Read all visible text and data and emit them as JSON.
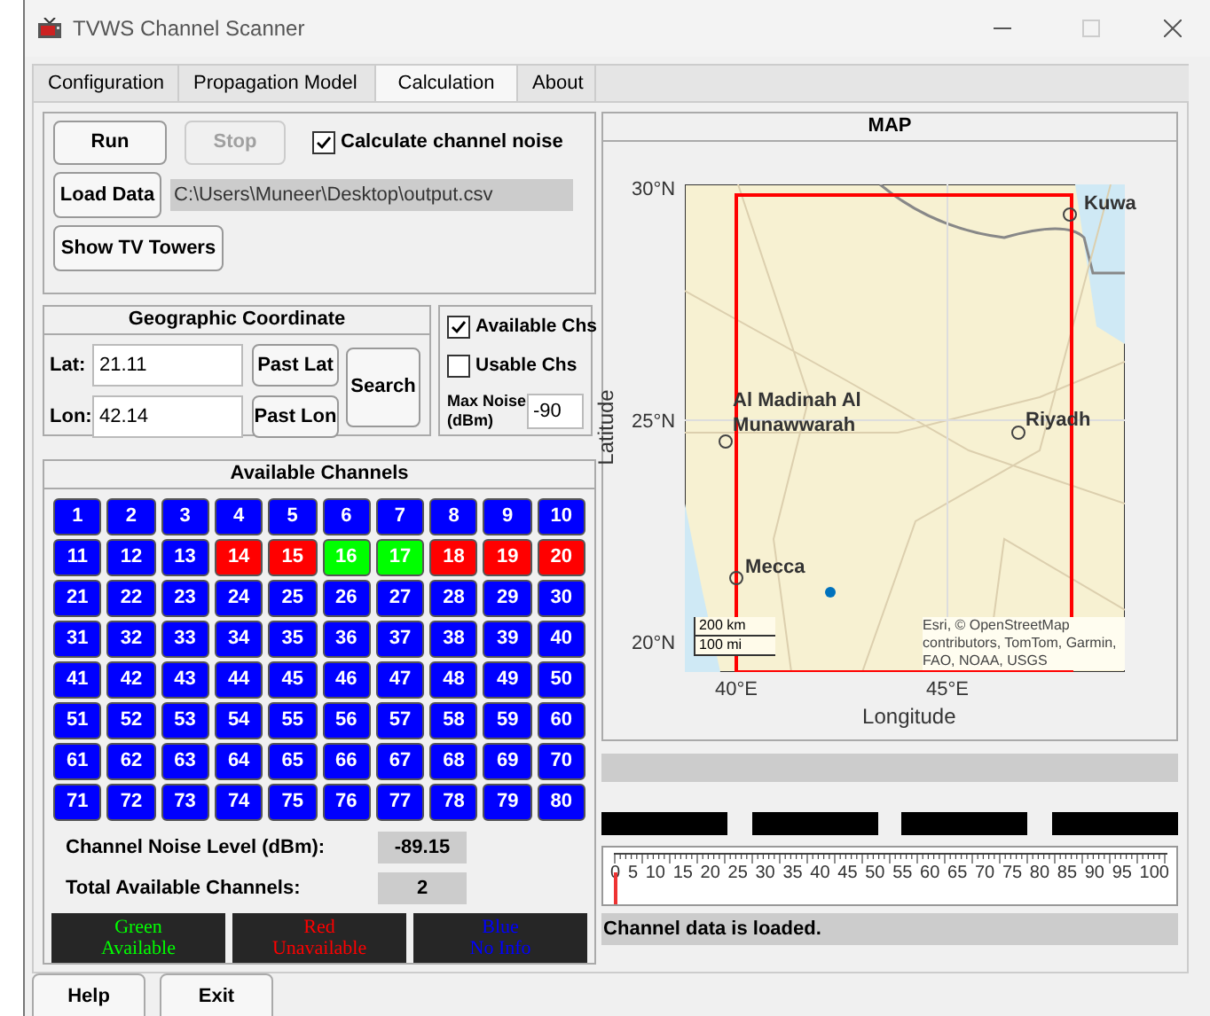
{
  "window": {
    "title": "TVWS Channel Scanner"
  },
  "tabs": [
    {
      "label": "Configuration",
      "selected": false
    },
    {
      "label": "Propagation Model",
      "selected": false
    },
    {
      "label": "Calculation",
      "selected": true
    },
    {
      "label": "About",
      "selected": false
    }
  ],
  "controls": {
    "run": {
      "label": "Run",
      "disabled": false
    },
    "stop": {
      "label": "Stop",
      "disabled": true
    },
    "calc_noise": {
      "label": "Calculate channel noise",
      "checked": true
    },
    "load_data": "Load Data",
    "file_path": "C:\\Users\\Muneer\\Desktop\\output.csv",
    "show_towers": "Show TV Towers"
  },
  "geo": {
    "title": "Geographic Coordinate",
    "lat_label": "Lat:",
    "lat": "21.11",
    "past_lat": "Past Lat",
    "lon_label": "Lon:",
    "lon": "42.14",
    "past_lon": "Past Lon",
    "search": "Search"
  },
  "filters": {
    "available": {
      "label": "Available Chs",
      "checked": true
    },
    "usable": {
      "label": "Usable Chs",
      "checked": false
    },
    "max_noise_label": "Max Noise (dBm)",
    "max_noise": "-90"
  },
  "channels": {
    "title": "Available Channels",
    "items": [
      {
        "label": "1",
        "kind": "noinfo"
      },
      {
        "label": "2",
        "kind": "noinfo"
      },
      {
        "label": "3",
        "kind": "noinfo"
      },
      {
        "label": "4",
        "kind": "noinfo"
      },
      {
        "label": "5",
        "kind": "noinfo"
      },
      {
        "label": "6",
        "kind": "noinfo"
      },
      {
        "label": "7",
        "kind": "noinfo"
      },
      {
        "label": "8",
        "kind": "noinfo"
      },
      {
        "label": "9",
        "kind": "noinfo"
      },
      {
        "label": "10",
        "kind": "noinfo"
      },
      {
        "label": "11",
        "kind": "noinfo"
      },
      {
        "label": "12",
        "kind": "noinfo"
      },
      {
        "label": "13",
        "kind": "noinfo"
      },
      {
        "label": "14",
        "kind": "unavailable"
      },
      {
        "label": "15",
        "kind": "unavailable"
      },
      {
        "label": "16",
        "kind": "available"
      },
      {
        "label": "17",
        "kind": "available"
      },
      {
        "label": "18",
        "kind": "unavailable"
      },
      {
        "label": "19",
        "kind": "unavailable"
      },
      {
        "label": "20",
        "kind": "unavailable"
      },
      {
        "label": "21",
        "kind": "noinfo"
      },
      {
        "label": "22",
        "kind": "noinfo"
      },
      {
        "label": "23",
        "kind": "noinfo"
      },
      {
        "label": "24",
        "kind": "noinfo"
      },
      {
        "label": "25",
        "kind": "noinfo"
      },
      {
        "label": "26",
        "kind": "noinfo"
      },
      {
        "label": "27",
        "kind": "noinfo"
      },
      {
        "label": "28",
        "kind": "noinfo"
      },
      {
        "label": "29",
        "kind": "noinfo"
      },
      {
        "label": "30",
        "kind": "noinfo"
      },
      {
        "label": "31",
        "kind": "noinfo"
      },
      {
        "label": "32",
        "kind": "noinfo"
      },
      {
        "label": "33",
        "kind": "noinfo"
      },
      {
        "label": "34",
        "kind": "noinfo"
      },
      {
        "label": "35",
        "kind": "noinfo"
      },
      {
        "label": "36",
        "kind": "noinfo"
      },
      {
        "label": "37",
        "kind": "noinfo"
      },
      {
        "label": "38",
        "kind": "noinfo"
      },
      {
        "label": "39",
        "kind": "noinfo"
      },
      {
        "label": "40",
        "kind": "noinfo"
      },
      {
        "label": "41",
        "kind": "noinfo"
      },
      {
        "label": "42",
        "kind": "noinfo"
      },
      {
        "label": "43",
        "kind": "noinfo"
      },
      {
        "label": "44",
        "kind": "noinfo"
      },
      {
        "label": "45",
        "kind": "noinfo"
      },
      {
        "label": "46",
        "kind": "noinfo"
      },
      {
        "label": "47",
        "kind": "noinfo"
      },
      {
        "label": "48",
        "kind": "noinfo"
      },
      {
        "label": "49",
        "kind": "noinfo"
      },
      {
        "label": "50",
        "kind": "noinfo"
      },
      {
        "label": "51",
        "kind": "noinfo"
      },
      {
        "label": "52",
        "kind": "noinfo"
      },
      {
        "label": "53",
        "kind": "noinfo"
      },
      {
        "label": "54",
        "kind": "noinfo"
      },
      {
        "label": "55",
        "kind": "noinfo"
      },
      {
        "label": "56",
        "kind": "noinfo"
      },
      {
        "label": "57",
        "kind": "noinfo"
      },
      {
        "label": "58",
        "kind": "noinfo"
      },
      {
        "label": "59",
        "kind": "noinfo"
      },
      {
        "label": "60",
        "kind": "noinfo"
      },
      {
        "label": "61",
        "kind": "noinfo"
      },
      {
        "label": "62",
        "kind": "noinfo"
      },
      {
        "label": "63",
        "kind": "noinfo"
      },
      {
        "label": "64",
        "kind": "noinfo"
      },
      {
        "label": "65",
        "kind": "noinfo"
      },
      {
        "label": "66",
        "kind": "noinfo"
      },
      {
        "label": "67",
        "kind": "noinfo"
      },
      {
        "label": "68",
        "kind": "noinfo"
      },
      {
        "label": "69",
        "kind": "noinfo"
      },
      {
        "label": "70",
        "kind": "noinfo"
      },
      {
        "label": "71",
        "kind": "noinfo"
      },
      {
        "label": "72",
        "kind": "noinfo"
      },
      {
        "label": "73",
        "kind": "noinfo"
      },
      {
        "label": "74",
        "kind": "noinfo"
      },
      {
        "label": "75",
        "kind": "noinfo"
      },
      {
        "label": "76",
        "kind": "noinfo"
      },
      {
        "label": "77",
        "kind": "noinfo"
      },
      {
        "label": "78",
        "kind": "noinfo"
      },
      {
        "label": "79",
        "kind": "noinfo"
      },
      {
        "label": "80",
        "kind": "noinfo"
      }
    ],
    "noise_label": "Channel Noise Level (dBm):",
    "noise_value": "-89.15",
    "total_label": "Total Available Channels:",
    "total_value": "2"
  },
  "legend": [
    {
      "kind": "available",
      "text": "Green\nAvailable"
    },
    {
      "kind": "unavailable",
      "text": "Red\nUnavailable"
    },
    {
      "kind": "noinfo",
      "text": "Blue\nNo Info"
    }
  ],
  "map": {
    "title": "MAP",
    "yticks": [
      "30°N",
      "25°N",
      "20°N"
    ],
    "xticks": [
      "40°E",
      "45°E"
    ],
    "xlabel": "Longitude",
    "ylabel": "Latitude",
    "cities": [
      {
        "name": "Kuwa"
      },
      {
        "name": "Al Madinah Al Munawwarah"
      },
      {
        "name": "Riyadh"
      },
      {
        "name": "Mecca"
      }
    ],
    "scale": [
      "200 km",
      "100 mi"
    ],
    "attribution": "Esri, © OpenStreetMap contributors, TomTom, Garmin, FAO, NOAA, USGS"
  },
  "gauge": {
    "level": 0,
    "labels": [
      "0",
      "5",
      "10",
      "15",
      "20",
      "25",
      "30",
      "35",
      "40",
      "45",
      "50",
      "55",
      "60",
      "65",
      "70",
      "75",
      "80",
      "85",
      "90",
      "95",
      "100"
    ]
  },
  "status": "Channel data is loaded.",
  "footer_buttons": [
    "Help",
    "Exit"
  ]
}
